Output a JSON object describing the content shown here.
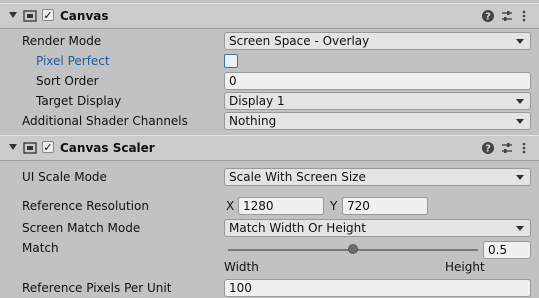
{
  "canvas": {
    "title": "Canvas",
    "enabled_mark": "✓",
    "fields": {
      "render_mode": {
        "label": "Render Mode",
        "value": "Screen Space - Overlay"
      },
      "pixel_perfect": {
        "label": "Pixel Perfect",
        "checked": false
      },
      "sort_order": {
        "label": "Sort Order",
        "value": "0"
      },
      "target_display": {
        "label": "Target Display",
        "value": "Display 1"
      },
      "additional_shader_channels": {
        "label": "Additional Shader Channels",
        "value": "Nothing"
      }
    }
  },
  "canvas_scaler": {
    "title": "Canvas Scaler",
    "enabled_mark": "✓",
    "fields": {
      "ui_scale_mode": {
        "label": "UI Scale Mode",
        "value": "Scale With Screen Size"
      },
      "reference_resolution": {
        "label": "Reference Resolution",
        "x_label": "X",
        "x": "1280",
        "y_label": "Y",
        "y": "720"
      },
      "screen_match_mode": {
        "label": "Screen Match Mode",
        "value": "Match Width Or Height"
      },
      "match": {
        "label": "Match",
        "value": "0.5",
        "level": 0.5,
        "left_label": "Width",
        "right_label": "Height"
      },
      "reference_pixels_per_unit": {
        "label": "Reference Pixels Per Unit",
        "value": "100"
      }
    }
  },
  "icons": {
    "component": "canvas-icon",
    "help": "help-icon",
    "presets": "presets-icon",
    "menu": "context-menu-icon",
    "foldout": "foldout-arrow-icon"
  },
  "colors": {
    "background": "#c2c2c2",
    "header": "#cbcbcb",
    "field": "#e4e4e4",
    "highlight_label": "#1f5a9e"
  }
}
